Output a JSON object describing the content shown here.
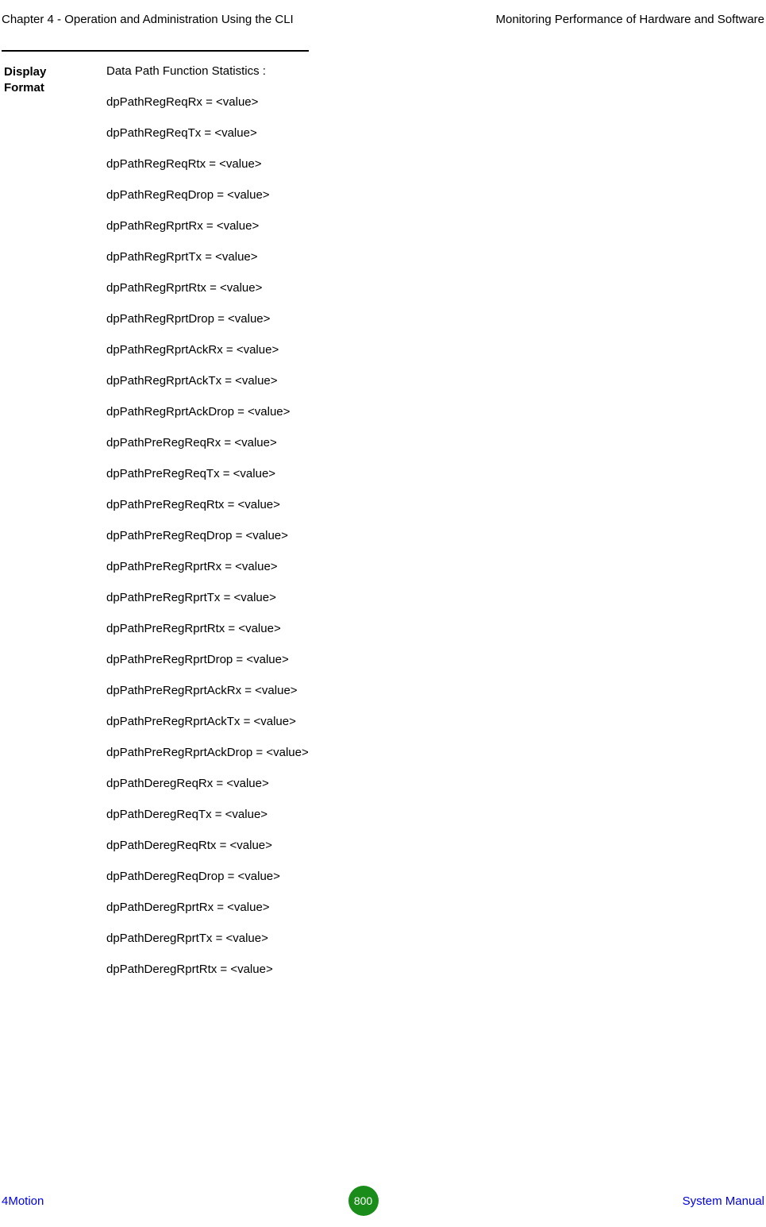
{
  "header": {
    "left": "Chapter 4 - Operation and Administration Using the CLI",
    "right": "Monitoring Performance of Hardware and Software"
  },
  "labelCell": {
    "line1": "Display",
    "line2": "Format"
  },
  "stats": {
    "title": "Data Path Function Statistics :",
    "lines": [
      "dpPathRegReqRx = <value>",
      "dpPathRegReqTx = <value>",
      "dpPathRegReqRtx = <value>",
      "dpPathRegReqDrop = <value>",
      "dpPathRegRprtRx = <value>",
      "dpPathRegRprtTx = <value>",
      "dpPathRegRprtRtx = <value>",
      "dpPathRegRprtDrop = <value>",
      "dpPathRegRprtAckRx = <value>",
      "dpPathRegRprtAckTx = <value>",
      "dpPathRegRprtAckDrop = <value>",
      "dpPathPreRegReqRx = <value>",
      "dpPathPreRegReqTx = <value>",
      "dpPathPreRegReqRtx = <value>",
      "dpPathPreRegReqDrop = <value>",
      "dpPathPreRegRprtRx = <value>",
      "dpPathPreRegRprtTx = <value>",
      "dpPathPreRegRprtRtx = <value>",
      "dpPathPreRegRprtDrop = <value>",
      "dpPathPreRegRprtAckRx = <value>",
      "dpPathPreRegRprtAckTx = <value>",
      "dpPathPreRegRprtAckDrop = <value>",
      "dpPathDeregReqRx = <value>",
      "dpPathDeregReqTx = <value>",
      "dpPathDeregReqRtx = <value>",
      "dpPathDeregReqDrop = <value>",
      "dpPathDeregRprtRx = <value>",
      "dpPathDeregRprtTx = <value>",
      "dpPathDeregRprtRtx = <value>"
    ]
  },
  "footer": {
    "left": "4Motion",
    "page": "800",
    "right": "System Manual"
  }
}
